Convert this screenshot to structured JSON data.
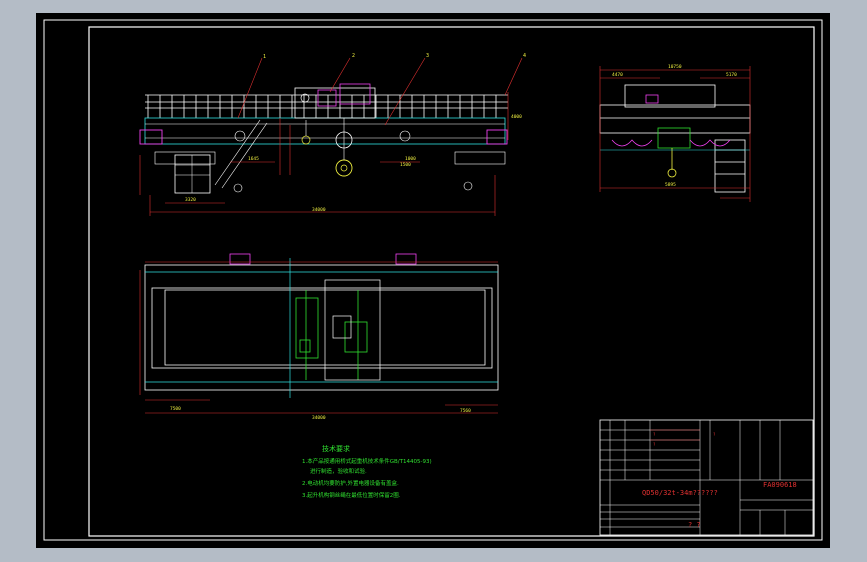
{
  "colors": {
    "viewport_bg": "#b4bcc6",
    "paper": "#000000",
    "frame": "#ffffff",
    "dim": "#e03030",
    "structure": "#ffffff",
    "cyan": "#30e0e0",
    "green": "#30e030",
    "magenta": "#f040f0",
    "yellow": "#f0f040"
  },
  "callouts": {
    "c1": "1",
    "c2": "2",
    "c3": "3",
    "c4": "4"
  },
  "front_view_dims": {
    "span": "34000",
    "left_a": "3320",
    "mid_a": "1645",
    "mid_b": "1500",
    "right_a": "1000",
    "height": "4000"
  },
  "side_view_dims": {
    "top_total": "10750",
    "left": "4470",
    "right": "5170",
    "base": "5895"
  },
  "plan_view_dims": {
    "overall": "34000",
    "left": "7500",
    "right": "7560"
  },
  "tech_notes": {
    "title": "技术要求",
    "line1": "1.本产品按通用桥式起重机技术条件GB/T14405-93)",
    "line1b": "进行制造，验收和试验.",
    "line2": "2.电动机均要防护,外置电器设备有盖盒.",
    "line3": "3.起升机构钢丝绳在最低位置时保留2圈."
  },
  "title_block": {
    "drawing_no": "FA090618",
    "title": "QD50/32t-34m??????",
    "sub": "? ?",
    "cell_a": "?",
    "cell_b": "?",
    "cell_c": "?"
  }
}
